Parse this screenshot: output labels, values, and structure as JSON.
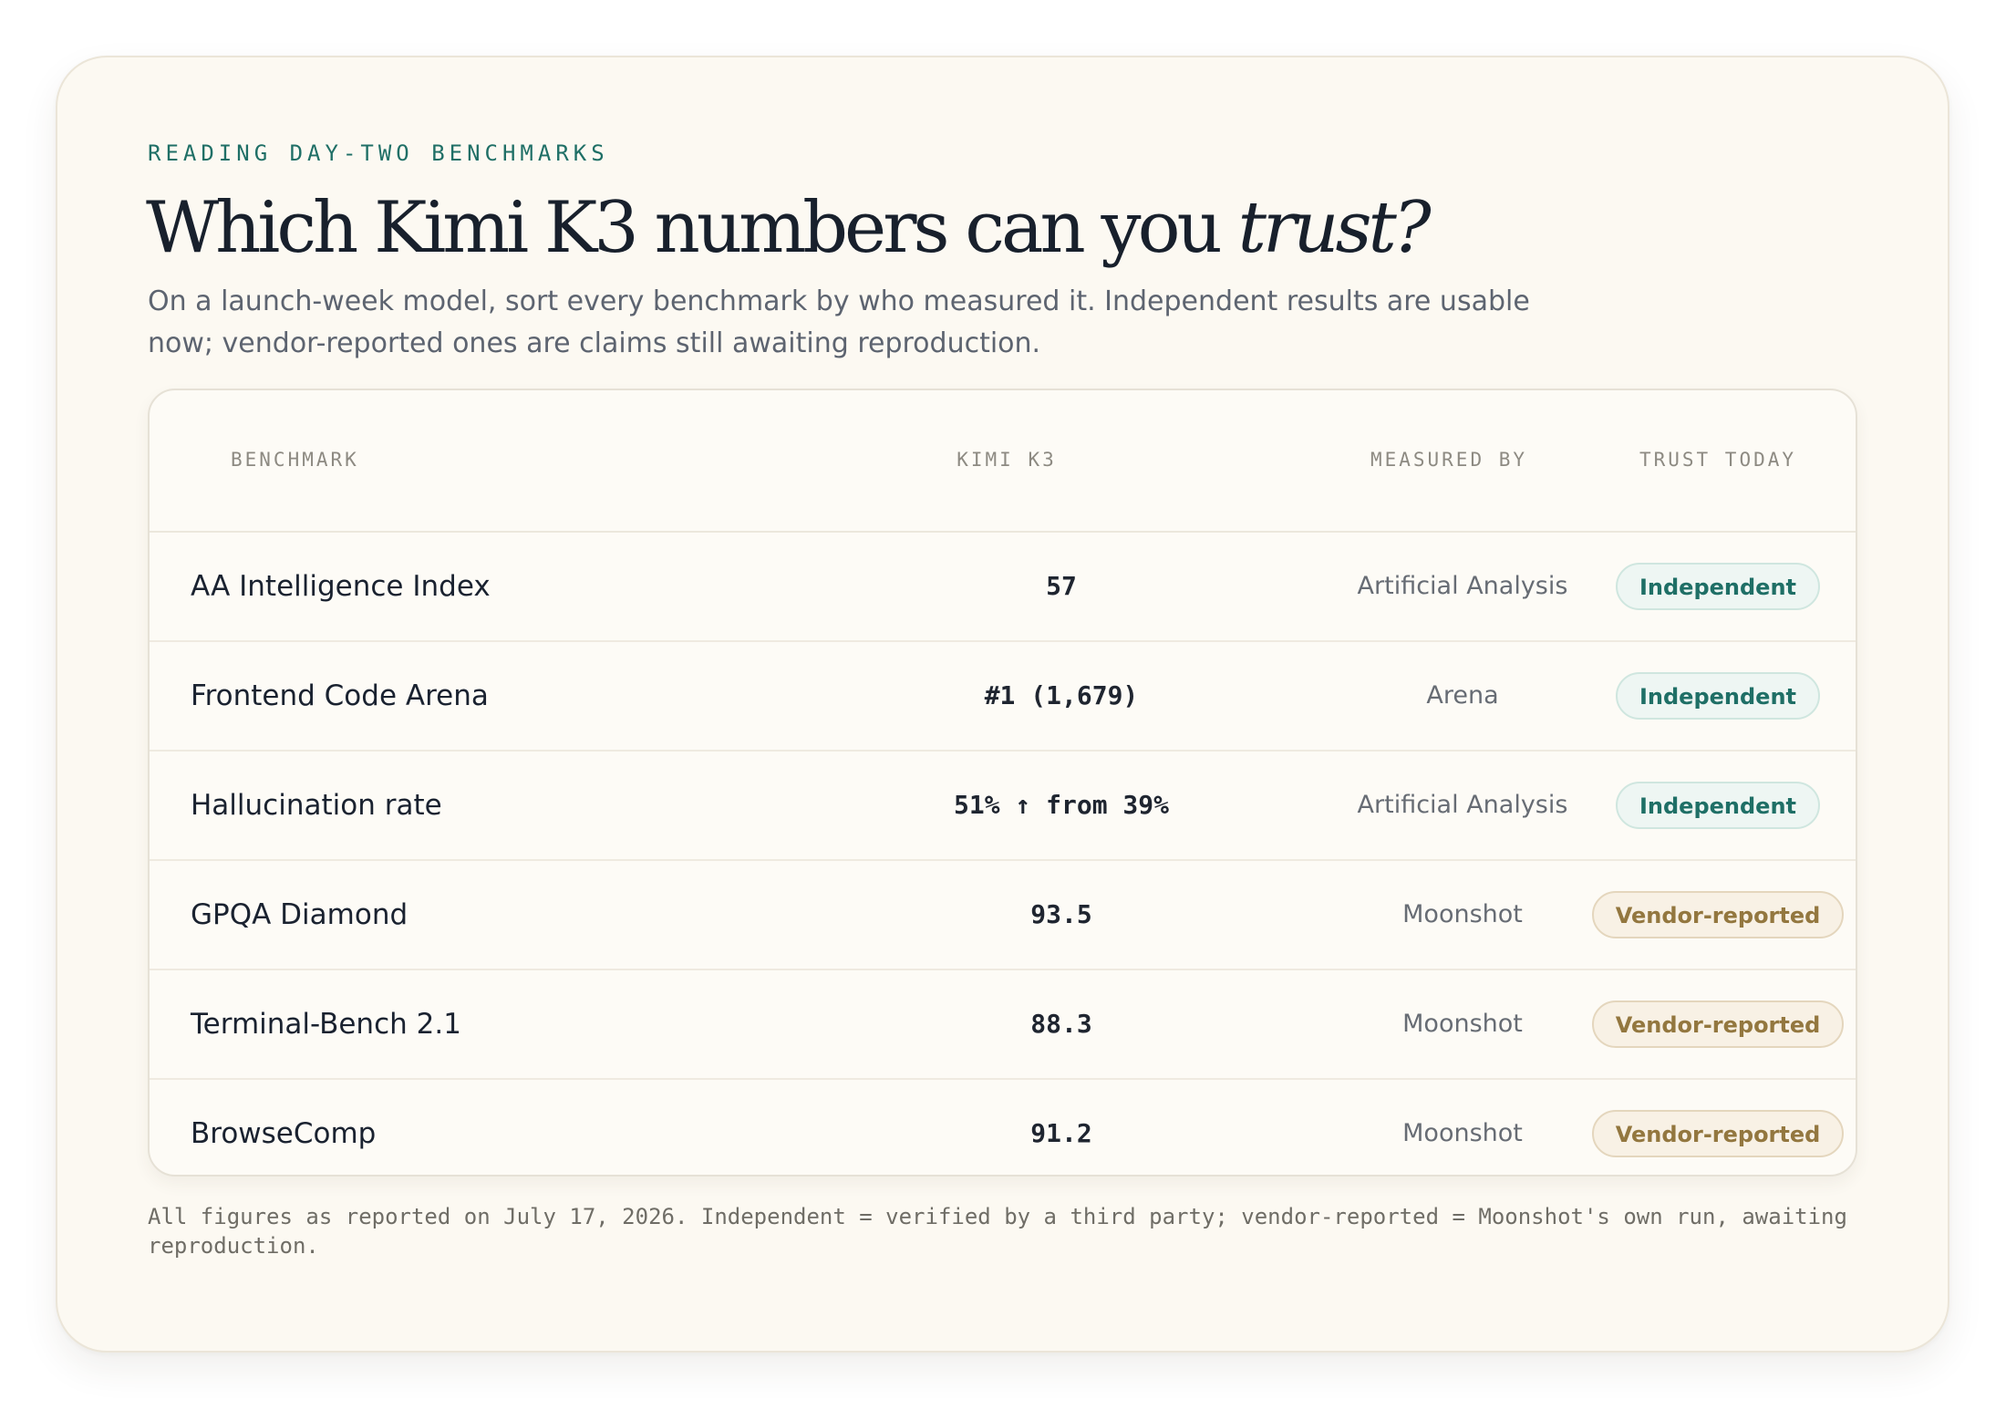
{
  "header": {
    "eyebrow": "READING DAY-TWO BENCHMARKS",
    "title_main": "Which Kimi K3 numbers can you ",
    "title_emphasis": "trust?",
    "subtitle": "On a launch-week model, sort every benchmark by who measured it. Independent results are usable now; vendor-reported ones are claims still awaiting reproduction."
  },
  "table": {
    "columns": {
      "benchmark": "BENCHMARK",
      "kimi": "KIMI K3",
      "measured_by": "MEASURED BY",
      "trust": "TRUST TODAY"
    },
    "rows": [
      {
        "benchmark": "AA Intelligence Index",
        "kimi": "57",
        "measured_by": "Artificial Analysis",
        "trust": "Independent",
        "trust_type": "independent"
      },
      {
        "benchmark": "Frontend Code Arena",
        "kimi": "#1 (1,679)",
        "measured_by": "Arena",
        "trust": "Independent",
        "trust_type": "independent"
      },
      {
        "benchmark": "Hallucination rate",
        "kimi": "51% ↑ from 39%",
        "measured_by": "Artificial Analysis",
        "trust": "Independent",
        "trust_type": "independent"
      },
      {
        "benchmark": "GPQA Diamond",
        "kimi": "93.5",
        "measured_by": "Moonshot",
        "trust": "Vendor-reported",
        "trust_type": "vendor"
      },
      {
        "benchmark": "Terminal-Bench 2.1",
        "kimi": "88.3",
        "measured_by": "Moonshot",
        "trust": "Vendor-reported",
        "trust_type": "vendor"
      },
      {
        "benchmark": "BrowseComp",
        "kimi": "91.2",
        "measured_by": "Moonshot",
        "trust": "Vendor-reported",
        "trust_type": "vendor"
      }
    ]
  },
  "footnote": "All figures as reported on July 17, 2026. Independent = verified by a third party; vendor-reported = Moonshot's own run, awaiting reproduction.",
  "colors": {
    "accent_teal": "#1f6f66",
    "vendor_gold": "#93773f",
    "card_background": "#fcf9f2"
  }
}
